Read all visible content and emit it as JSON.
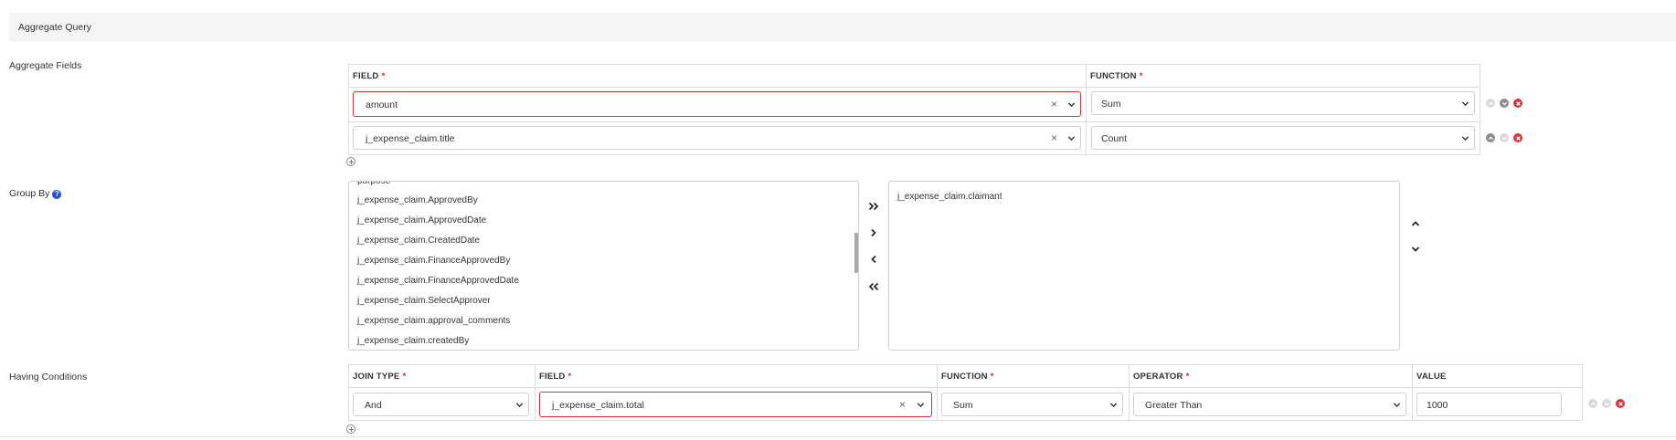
{
  "header": {
    "title": "Aggregate Query"
  },
  "aggregate_fields": {
    "label": "Aggregate Fields",
    "col_field": "FIELD",
    "col_function": "FUNCTION",
    "required_mark": "*",
    "rows": [
      {
        "field": "amount",
        "function": "Sum"
      },
      {
        "field": "j_expense_claim.title",
        "function": "Count"
      }
    ],
    "clear_glyph": "×"
  },
  "group_by": {
    "label": "Group By",
    "help_glyph": "?",
    "available_partial": "purpose",
    "available": [
      "j_expense_claim.ApprovedBy",
      "j_expense_claim.ApprovedDate",
      "j_expense_claim.CreatedDate",
      "j_expense_claim.FinanceApprovedBy",
      "j_expense_claim.FinanceApprovedDate",
      "j_expense_claim.SelectApprover",
      "j_expense_claim.approval_comments",
      "j_expense_claim.createdBy"
    ],
    "selected": [
      "j_expense_claim.claimant"
    ]
  },
  "having": {
    "label": "Having Conditions",
    "col_join_type": "JOIN TYPE",
    "col_field": "FIELD",
    "col_function": "FUNCTION",
    "col_operator": "OPERATOR",
    "col_value": "VALUE",
    "required_mark": "*",
    "row": {
      "join_type": "And",
      "field": "j_expense_claim.total",
      "function": "Sum",
      "operator": "Greater Than",
      "value": "1000"
    },
    "clear_glyph": "×"
  },
  "colors": {
    "error_border": "#d7343a",
    "remove_icon": "#e0343b",
    "help_icon": "#1f4fd8"
  }
}
